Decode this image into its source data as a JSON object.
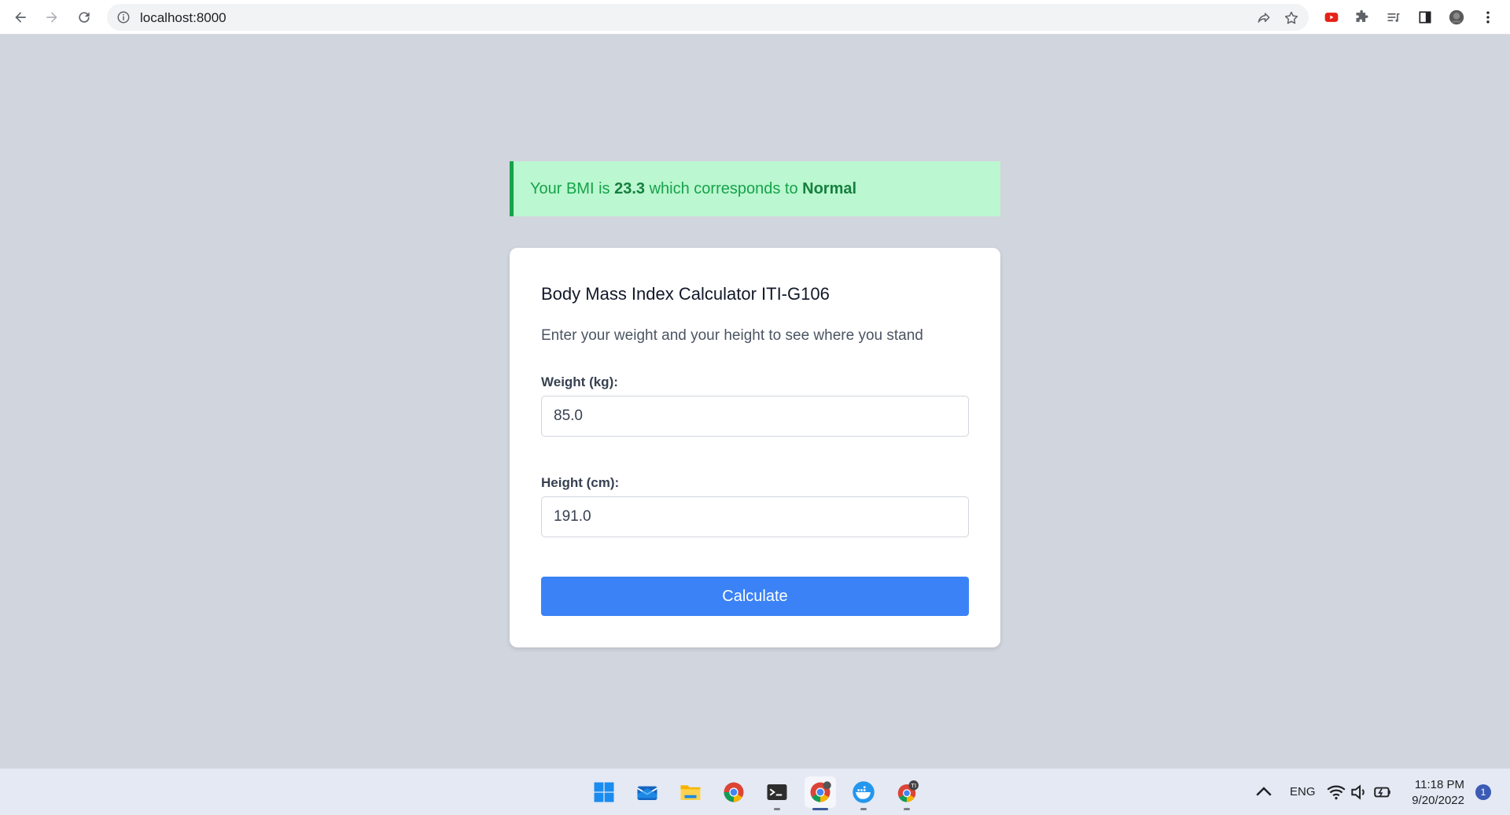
{
  "browser": {
    "url": "localhost:8000",
    "icons": [
      "back-icon",
      "forward-icon",
      "reload-icon",
      "site-info-icon",
      "share-icon",
      "bookmark-star-icon",
      "youtube-extension-icon",
      "extensions-puzzle-icon",
      "reading-list-icon",
      "side-panel-icon",
      "profile-avatar",
      "more-menu-icon"
    ]
  },
  "alert": {
    "prefix": "Your BMI is",
    "bmi_value": "23.3",
    "middle": "which corresponds to",
    "category": "Normal",
    "colors": {
      "background": "#bbf7d0",
      "border": "#16a34a",
      "text": "#16a34a"
    }
  },
  "form": {
    "title": "Body Mass Index Calculator ITI-G106",
    "description": "Enter your weight and your height to see where you stand",
    "weight_label": "Weight (kg):",
    "weight_value": "85.0",
    "height_label": "Height (cm):",
    "height_value": "191.0",
    "submit_label": "Calculate",
    "accent": "#3b82f6"
  },
  "taskbar": {
    "apps": [
      "windows-start-icon",
      "mail-icon",
      "file-explorer-icon",
      "chrome-icon",
      "terminal-icon",
      "chrome-profile-icon",
      "docker-icon",
      "chrome-ti-icon"
    ],
    "chrome_badge": "TI",
    "tray": {
      "language": "ENG",
      "time": "11:18 PM",
      "date": "9/20/2022",
      "notification_count": "1"
    }
  }
}
